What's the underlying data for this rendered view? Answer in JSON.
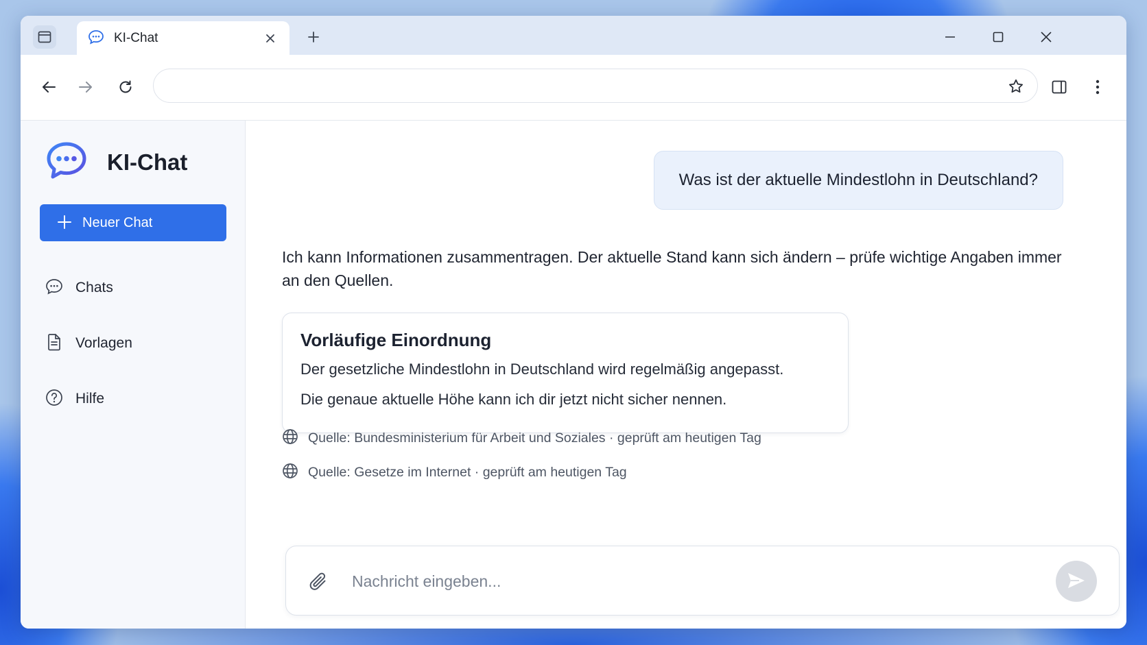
{
  "browser": {
    "tab_title": "KI-Chat",
    "address_value": "",
    "icons": {
      "tabstrip": "tab-overview-icon",
      "tab_favicon": "chat-bubble-icon",
      "tab_close": "close-icon",
      "new_tab": "plus-icon",
      "minimize": "minimize-icon",
      "maximize": "maximize-icon",
      "close_window": "close-icon",
      "back": "arrow-left-icon",
      "forward": "arrow-right-icon",
      "reload": "reload-icon",
      "bookmark": "star-icon",
      "side_panel": "side-panel-icon",
      "menu": "more-vertical-icon"
    }
  },
  "sidebar": {
    "brand_title": "KI-Chat",
    "new_chat_label": "Neuer Chat",
    "items": [
      {
        "label": "Chats",
        "icon": "chat-bubble-icon"
      },
      {
        "label": "Vorlagen",
        "icon": "document-icon"
      },
      {
        "label": "Hilfe",
        "icon": "help-circle-icon"
      }
    ]
  },
  "conversation": {
    "user_message": "Was ist der aktuelle Mindestlohn in Deutschland?",
    "assistant_intro": "Ich kann Informationen zusammentragen. Der aktuelle Stand kann sich ändern – prüfe wichtige Angaben immer an den Quellen.",
    "card": {
      "title": "Vorläufige Einordnung",
      "lines": [
        "Der gesetzliche Mindestlohn in Deutschland wird regelmäßig angepasst.",
        "Die genaue aktuelle Höhe kann ich dir jetzt nicht sicher nennen."
      ]
    },
    "sources": [
      {
        "text": "Quelle: Bundesministerium für Arbeit und Soziales · geprüft am heutigen Tag",
        "icon": "globe-icon"
      },
      {
        "text": "Quelle: Gesetze im Internet · geprüft am heutigen Tag",
        "icon": "globe-icon"
      }
    ]
  },
  "composer": {
    "placeholder": "Nachricht eingeben...",
    "value": "",
    "icons": {
      "attach": "paperclip-icon",
      "send": "send-icon"
    }
  },
  "colors": {
    "accent": "#2f6fe8",
    "user_bubble": "#eaf1fc",
    "sidebar_bg": "#f6f8fc",
    "titlebar_bg": "#dfe8f6",
    "send_disabled": "#d9dce2"
  }
}
